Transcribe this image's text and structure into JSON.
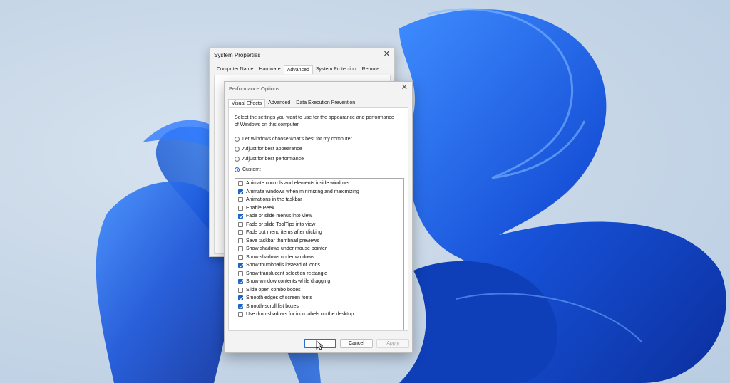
{
  "system_properties": {
    "title": "System Properties",
    "close_glyph": "✕",
    "tabs": [
      {
        "label": "Computer Name"
      },
      {
        "label": "Hardware"
      },
      {
        "label": "Advanced"
      },
      {
        "label": "System Protection"
      },
      {
        "label": "Remote"
      }
    ],
    "active_tab": "Advanced"
  },
  "performance_options": {
    "title": "Performance Options",
    "close_glyph": "✕",
    "tabs": [
      {
        "label": "Visual Effects"
      },
      {
        "label": "Advanced"
      },
      {
        "label": "Data Execution Prevention"
      }
    ],
    "active_tab": "Visual Effects",
    "description": "Select the settings you want to use for the appearance and performance of Windows on this computer.",
    "radios": [
      {
        "label": "Let Windows choose what's best for my computer",
        "checked": false
      },
      {
        "label": "Adjust for best appearance",
        "checked": false
      },
      {
        "label": "Adjust for best performance",
        "checked": false
      },
      {
        "label": "Custom:",
        "checked": true
      }
    ],
    "effects": [
      {
        "label": "Animate controls and elements inside windows",
        "checked": false
      },
      {
        "label": "Animate windows when minimizing and maximizing",
        "checked": true
      },
      {
        "label": "Animations in the taskbar",
        "checked": false
      },
      {
        "label": "Enable Peek",
        "checked": false
      },
      {
        "label": "Fade or slide menus into view",
        "checked": true
      },
      {
        "label": "Fade or slide ToolTips into view",
        "checked": false
      },
      {
        "label": "Fade out menu items after clicking",
        "checked": false
      },
      {
        "label": "Save taskbar thumbnail previews",
        "checked": false
      },
      {
        "label": "Show shadows under mouse pointer",
        "checked": false
      },
      {
        "label": "Show shadows under windows",
        "checked": false
      },
      {
        "label": "Show thumbnails instead of icons",
        "checked": true
      },
      {
        "label": "Show translucent selection rectangle",
        "checked": false
      },
      {
        "label": "Show window contents while dragging",
        "checked": true
      },
      {
        "label": "Slide open combo boxes",
        "checked": false
      },
      {
        "label": "Smooth edges of screen fonts",
        "checked": true
      },
      {
        "label": "Smooth-scroll list boxes",
        "checked": true
      },
      {
        "label": "Use drop shadows for icon labels on the desktop",
        "checked": false
      }
    ],
    "buttons": {
      "cancel": "Cancel",
      "apply": "Apply"
    }
  },
  "colors": {
    "accent": "#1a63c9",
    "wallpaper_bloom": "#1e5fe0"
  }
}
